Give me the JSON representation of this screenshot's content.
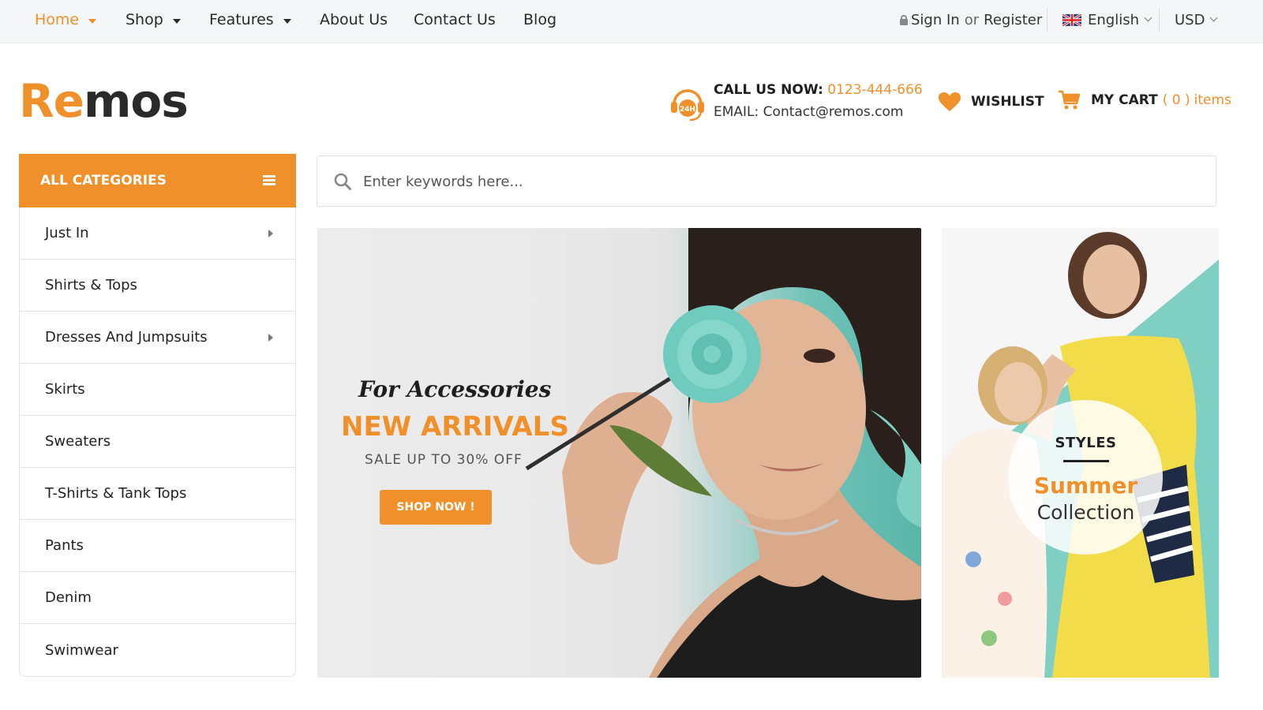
{
  "nav": {
    "items": [
      {
        "label": "Home",
        "has_caret": true,
        "active": true
      },
      {
        "label": "Shop",
        "has_caret": true,
        "active": false
      },
      {
        "label": "Features",
        "has_caret": true,
        "active": false
      },
      {
        "label": "About Us",
        "has_caret": false,
        "active": false
      },
      {
        "label": "Contact Us",
        "has_caret": false,
        "active": false
      },
      {
        "label": "Blog",
        "has_caret": false,
        "active": false
      }
    ]
  },
  "account": {
    "sign_in": "Sign In",
    "or": "or",
    "register": "Register"
  },
  "language": {
    "label": "English",
    "flag_icon": "uk-flag-icon"
  },
  "currency": {
    "label": "USD"
  },
  "logo": {
    "part1": "Re",
    "part2": "mos"
  },
  "contact": {
    "call_label": "CALL US NOW:",
    "phone": "0123-444-666",
    "email_label": "EMAIL:",
    "email": "Contact@remos.com",
    "badge": "24H"
  },
  "wishlist": {
    "label": "WISHLIST"
  },
  "cart": {
    "label": "MY CART",
    "count_text": "( 0 )",
    "items_label": "items"
  },
  "categories": {
    "header": "ALL CATEGORIES",
    "items": [
      {
        "label": "Just In",
        "has_submenu": true
      },
      {
        "label": "Shirts & Tops",
        "has_submenu": false
      },
      {
        "label": "Dresses And Jumpsuits",
        "has_submenu": true
      },
      {
        "label": "Skirts",
        "has_submenu": false
      },
      {
        "label": "Sweaters",
        "has_submenu": false
      },
      {
        "label": "T-Shirts & Tank Tops",
        "has_submenu": false
      },
      {
        "label": "Pants",
        "has_submenu": false
      },
      {
        "label": "Denim",
        "has_submenu": false
      },
      {
        "label": "Swimwear",
        "has_submenu": false
      }
    ]
  },
  "search": {
    "placeholder": "Enter keywords here..."
  },
  "banner_main": {
    "tagline": "For Accessories",
    "title": "NEW ARRIVALS",
    "subtitle": "SALE UP TO 30% OFF",
    "button": "SHOP NOW !"
  },
  "banner_side": {
    "kicker": "STYLES",
    "title": "Summer",
    "subtitle": "Collection"
  },
  "colors": {
    "accent": "#f0902a",
    "teal": "#5ab6aa",
    "text": "#222222"
  }
}
